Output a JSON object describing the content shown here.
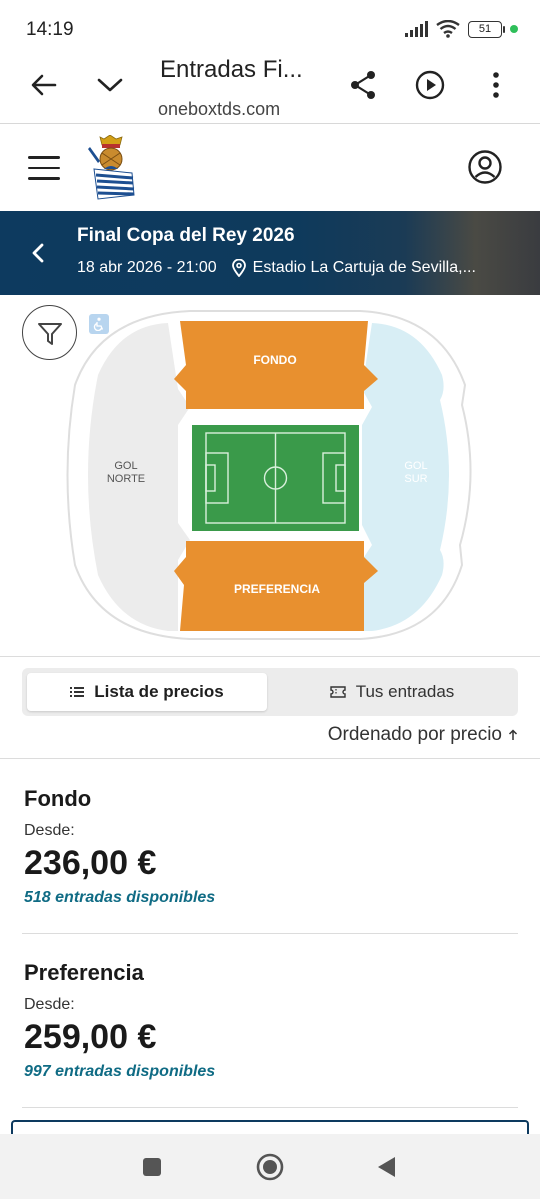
{
  "status_bar": {
    "time": "14:19",
    "battery": "51"
  },
  "toolbar": {
    "title": "Entradas Fi...",
    "url": "oneboxtds.com"
  },
  "event": {
    "title": "Final Copa del Rey 2026",
    "datetime": "18 abr 2026 - 21:00",
    "venue": "Estadio La Cartuja de Sevilla,..."
  },
  "map": {
    "sections": {
      "fondo": "FONDO",
      "preferencia": "PREFERENCIA",
      "gol_norte_1": "GOL",
      "gol_norte_2": "NORTE",
      "gol_sur_1": "GOL",
      "gol_sur_2": "SUR"
    },
    "colors": {
      "available": "#e8902f",
      "unavailable": "#ececec",
      "selected_side": "#d6eef5",
      "pitch": "#3a9a4a"
    }
  },
  "tabs": {
    "price_list": "Lista de precios",
    "your_tickets": "Tus entradas"
  },
  "sort_label": "Ordenado por precio",
  "prices": [
    {
      "name": "Fondo",
      "from_label": "Desde:",
      "price": "236,00 €",
      "availability": "518 entradas disponibles"
    },
    {
      "name": "Preferencia",
      "from_label": "Desde:",
      "price": "259,00 €",
      "availability": "997 entradas disponibles"
    }
  ],
  "icons": {
    "back": "back-arrow-icon",
    "collapse": "chevron-down-icon",
    "share": "share-icon",
    "play": "play-icon",
    "more": "more-vert-icon",
    "menu": "hamburger-icon",
    "user": "user-icon",
    "filter": "filter-icon",
    "location": "location-pin-icon"
  }
}
